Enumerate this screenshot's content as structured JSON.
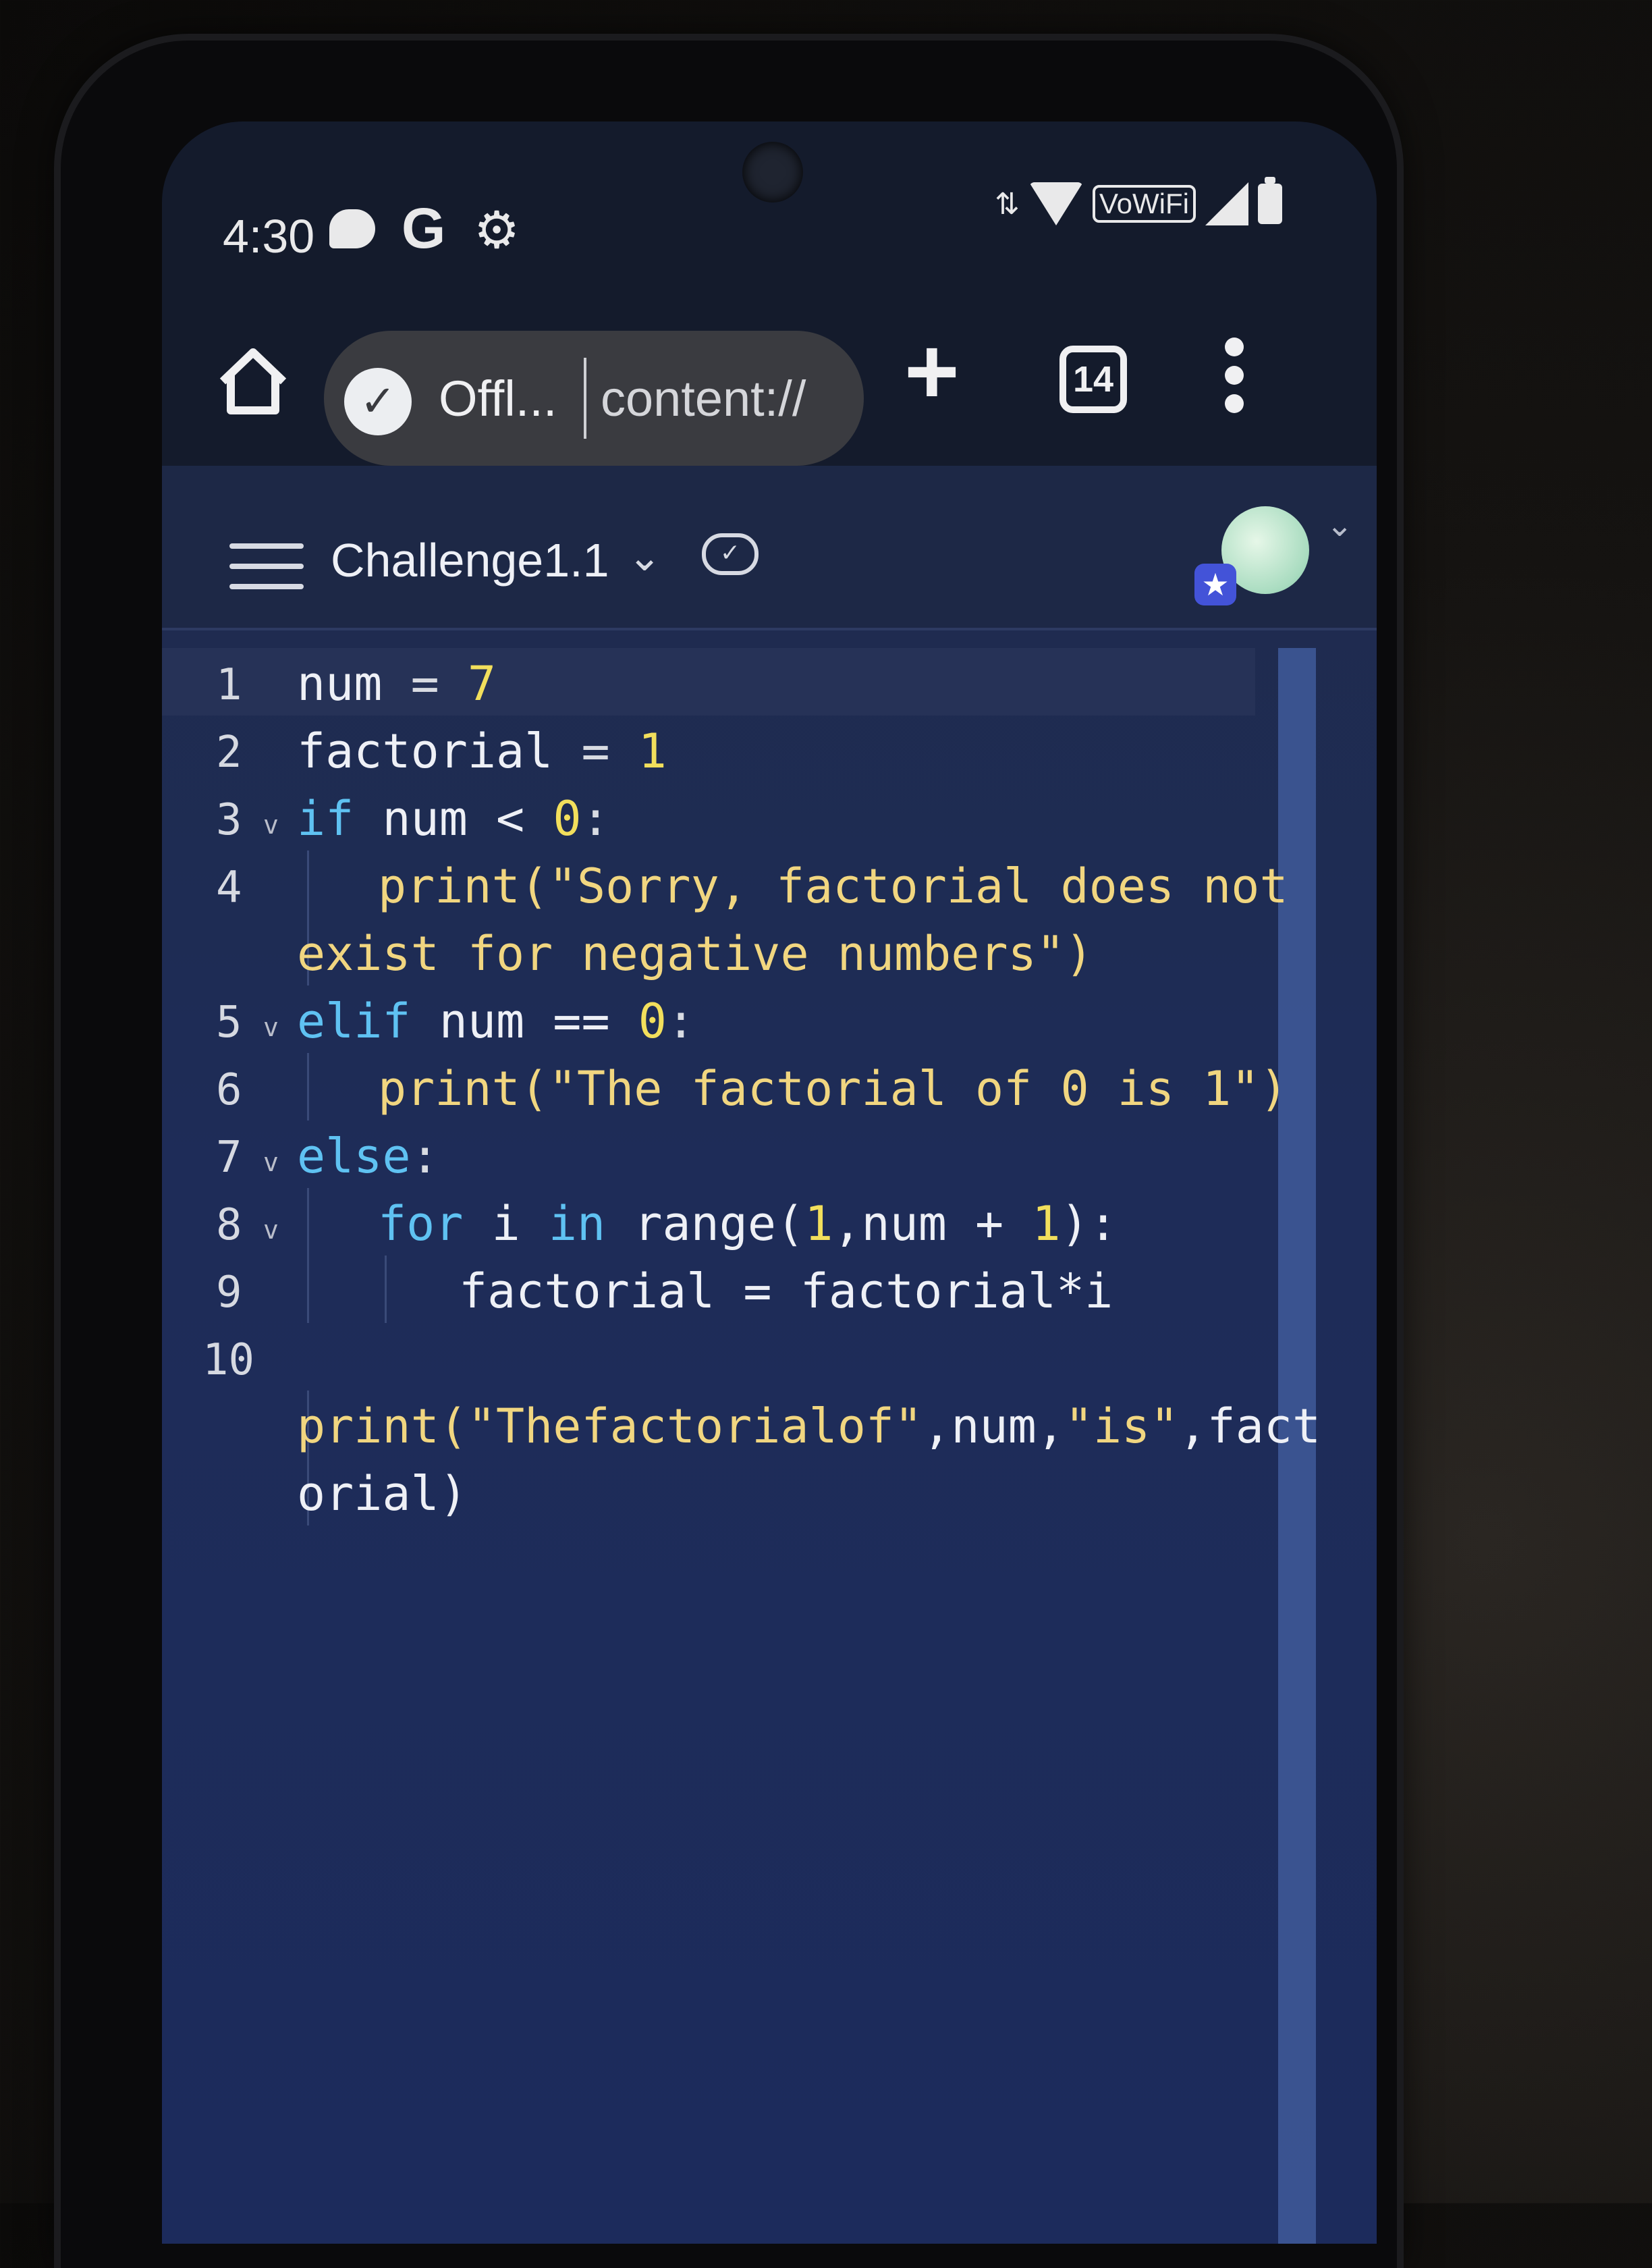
{
  "status_bar": {
    "time": "4:30",
    "left_icons": [
      "chat-bubble-icon",
      "google-icon",
      "gear-icon"
    ],
    "vowifi_label": "VoWiFi",
    "right_icons": [
      "data-arrows-icon",
      "wifi-icon",
      "signal-icon",
      "battery-icon"
    ]
  },
  "browser": {
    "offline_chip": "Offl...",
    "url": "content://",
    "tab_count": "14",
    "new_tab_symbol": "+"
  },
  "app": {
    "title": "Challenge1.1",
    "title_chevron": "⌄",
    "saved_icon": "cloud-check-icon",
    "avatar_badge": "★",
    "avatar_chevron": "⌄"
  },
  "editor": {
    "lines": [
      {
        "number": "1",
        "fold": ""
      },
      {
        "number": "2",
        "fold": ""
      },
      {
        "number": "3",
        "fold": "v"
      },
      {
        "number": "4",
        "fold": ""
      },
      {
        "number": "5",
        "fold": "v"
      },
      {
        "number": "6",
        "fold": ""
      },
      {
        "number": "7",
        "fold": "v"
      },
      {
        "number": "8",
        "fold": "v"
      },
      {
        "number": "9",
        "fold": ""
      },
      {
        "number": "10",
        "fold": ""
      }
    ],
    "code": {
      "l1": {
        "a": "num",
        "b": " = ",
        "c": "7"
      },
      "l2": {
        "a": "factorial",
        "b": " = ",
        "c": "1"
      },
      "l3": {
        "kw": "if",
        "a": " num < ",
        "c": "0",
        "d": ":"
      },
      "l4a": "print(\"Sorry, factorial does not",
      "l4b": "exist for negative numbers\")",
      "l5": {
        "kw": "elif",
        "a": " num == ",
        "c": "0",
        "d": ":"
      },
      "l6": "print(\"The factorial of 0 is 1\")",
      "l7": {
        "kw": "else",
        "d": ":"
      },
      "l8": {
        "kw1": "for",
        "a": " i ",
        "kw2": "in",
        "b": " range(",
        "c": "1",
        "d": ",num + ",
        "e": "1",
        "f": "):"
      },
      "l9": "factorial = factorial*i",
      "l10a": {
        "p": "print(",
        "s1": "\"Thefactorialof\"",
        "m": ",num,",
        "s2": "\"is\"",
        "e": ",fact"
      },
      "l10b": "orial)"
    }
  }
}
